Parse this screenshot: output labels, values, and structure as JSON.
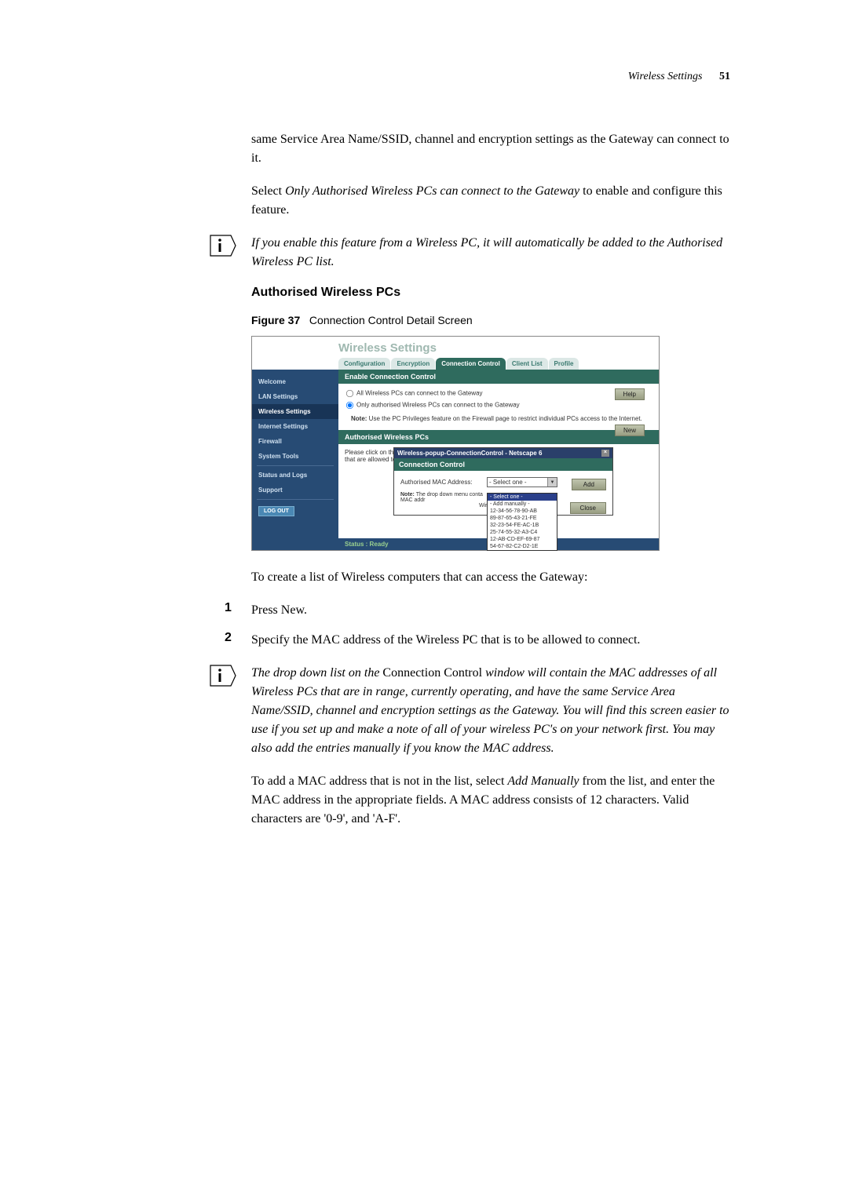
{
  "header": {
    "section": "Wireless Settings",
    "page_num": "51"
  },
  "intro1": "same Service Area Name/SSID, channel and encryption settings as the Gateway can connect to it.",
  "intro2_pre": "Select ",
  "intro2_em": "Only Authorised Wireless PCs can connect to the Gateway",
  "intro2_post": " to enable and configure this feature.",
  "note1": "If you enable this feature from a Wireless PC, it will automatically be added to the Authorised Wireless PC list.",
  "subhead": "Authorised Wireless PCs",
  "figure": {
    "label": "Figure 37",
    "caption": "Connection Control Detail Screen"
  },
  "screenshot": {
    "main_title": "Wireless Settings",
    "tabs": [
      "Configuration",
      "Encryption",
      "Connection Control",
      "Client List",
      "Profile"
    ],
    "sidebar": [
      "Welcome",
      "LAN Settings",
      "Wireless Settings",
      "Internet Settings",
      "Firewall",
      "System Tools",
      "Status and Logs",
      "Support"
    ],
    "logout": "LOG OUT",
    "panel1_title": "Enable Connection Control",
    "radio1": "All Wireless PCs can connect to the Gateway",
    "radio2": "Only authorised Wireless PCs can connect to the Gateway",
    "help": "Help",
    "firewall_note_b": "Note:",
    "firewall_note": " Use the PC Privileges feature on the Firewall page to restrict individual PCs access to the Internet.",
    "new_btn": "New",
    "panel2_title": "Authorised Wireless PCs",
    "auth_note": "Please click on the \"New\" button on the right to specify Wireless PCs that are allowed to connect to the Gateway.",
    "popup": {
      "titlebar": "Wireless-popup-ConnectionControl - Netscape 6",
      "head": "Connection Control",
      "mac_label": "Authorised MAC Address:",
      "selected": "- Select one -",
      "options": [
        "- Select one -",
        "- Add manually -",
        "12-34-56-78-90-AB",
        "89-87-65-43-21-FE",
        "32-23-54-FE-AC-1B",
        "25-74-55-32-A3-C4",
        "12-AB-CD-EF-69-87",
        "54-67-82-C2-D2-1E"
      ],
      "note_b": "Note:",
      "note_rest": " The drop down menu conta MAC addr",
      "note_tail": "Wireless",
      "add": "Add",
      "close": "Close"
    },
    "status": "Status : Ready"
  },
  "after_fig": "To create a list of Wireless computers that can access the Gateway:",
  "steps": {
    "s1_pre": "Press ",
    "s1_em": "New.",
    "s2": "Specify the MAC address of the Wireless PC that is to be allowed to connect."
  },
  "note2_pre": "The drop down list on the ",
  "note2_norm": "Connection Control",
  "note2_post": " window will contain the MAC addresses of all Wireless PCs that are in range, currently operating, and have the same Service Area Name/SSID, channel and encryption settings as the Gateway. You will find this screen easier to use if you set up and make a note of all of your wireless PC's on your network first. You may also add the entries manually if you know the MAC address.",
  "closing_pre": "To add a MAC address that is not in the list, select ",
  "closing_em": "Add Manually",
  "closing_post": " from the list, and enter the MAC address in the appropriate fields. A MAC address consists of 12 characters. Valid characters are '0-9', and 'A-F'."
}
